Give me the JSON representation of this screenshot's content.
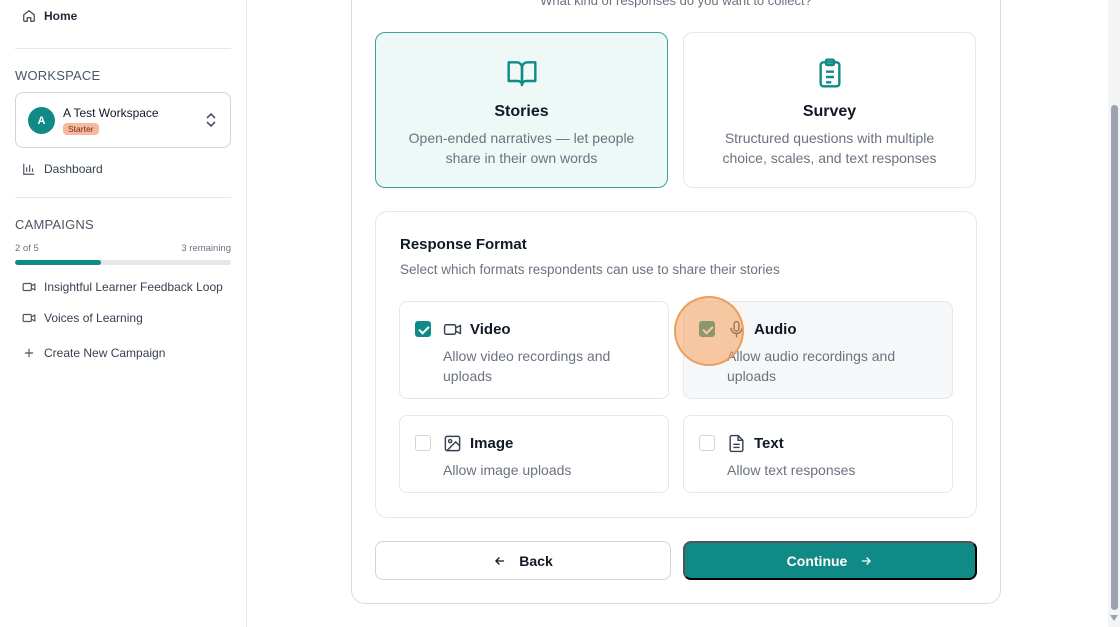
{
  "sidebar": {
    "home_label": "Home",
    "workspace_section": "WORKSPACE",
    "workspace": {
      "avatar_letter": "A",
      "name": "A Test Workspace",
      "plan_badge": "Starter"
    },
    "dashboard_label": "Dashboard",
    "campaigns_section": "CAMPAIGNS",
    "campaign_progress": {
      "count_text": "2 of 5",
      "remaining_text": "3 remaining",
      "fraction": 0.4
    },
    "campaigns": [
      {
        "label": "Insightful Learner Feedback Loop",
        "icon": "video-icon"
      },
      {
        "label": "Voices of Learning",
        "icon": "video-icon"
      }
    ],
    "create_label": "Create New Campaign"
  },
  "main": {
    "question": "What kind of responses do you want to collect?",
    "types": [
      {
        "title": "Stories",
        "description": "Open-ended narratives — let people share in their own words",
        "icon": "book-open-icon",
        "selected": true
      },
      {
        "title": "Survey",
        "description": "Structured questions with multiple choice, scales, and text responses",
        "icon": "clipboard-list-icon",
        "selected": false
      }
    ],
    "format": {
      "title": "Response Format",
      "subtitle": "Select which formats respondents can use to share their stories",
      "options": [
        {
          "label": "Video",
          "description": "Allow video recordings and uploads",
          "icon": "video-icon",
          "checked": true
        },
        {
          "label": "Audio",
          "description": "Allow audio recordings and uploads",
          "icon": "microphone-icon",
          "checked": true
        },
        {
          "label": "Image",
          "description": "Allow image uploads",
          "icon": "image-icon",
          "checked": false
        },
        {
          "label": "Text",
          "description": "Allow text responses",
          "icon": "file-text-icon",
          "checked": false
        }
      ]
    },
    "back_label": "Back",
    "continue_label": "Continue"
  },
  "colors": {
    "accent": "#0f8a86",
    "badge": "#f6b89f",
    "cursor_highlight": "#f5a05a"
  }
}
